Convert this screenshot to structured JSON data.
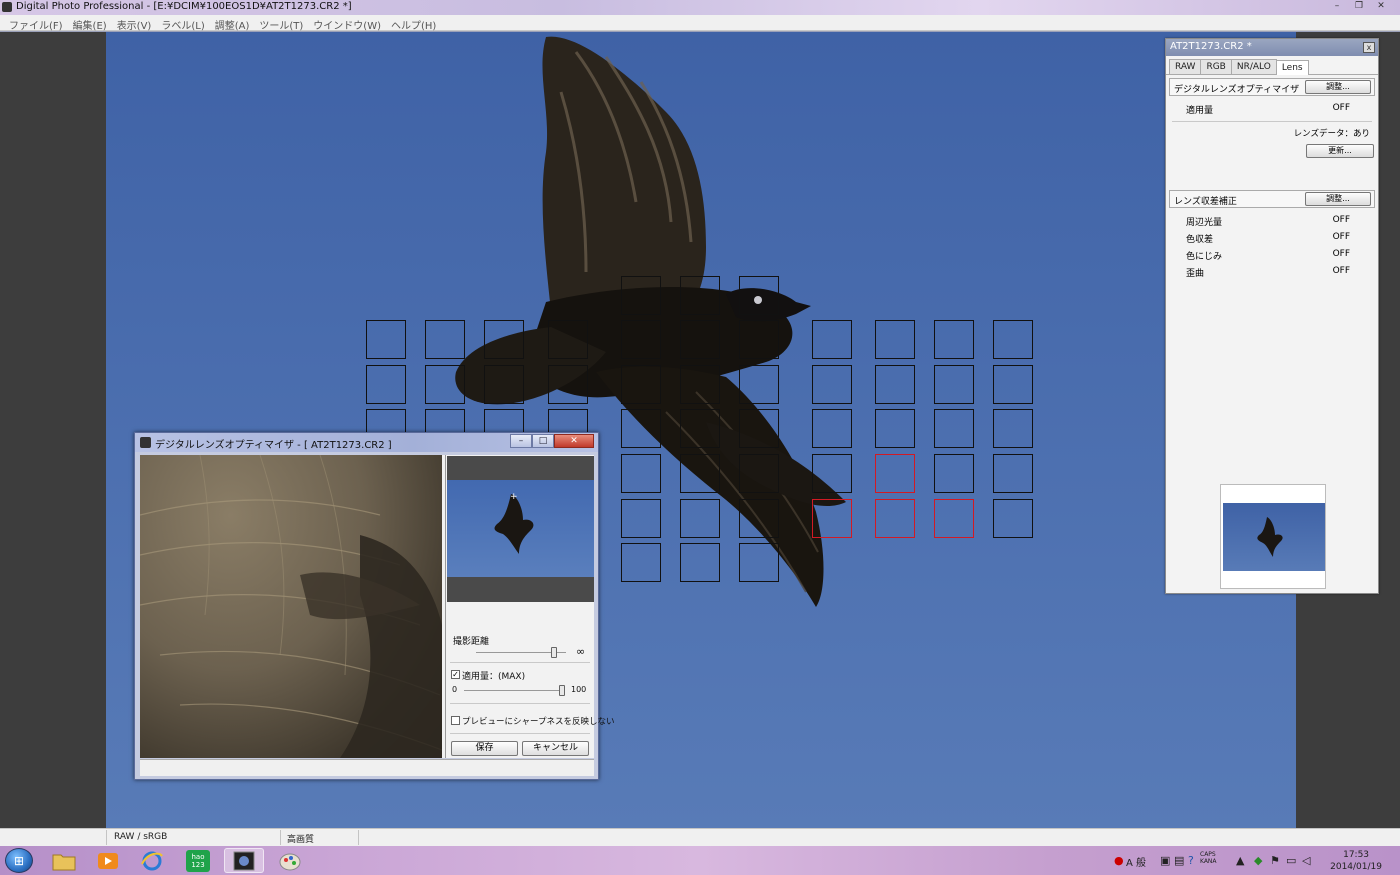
{
  "window": {
    "title": "Digital Photo Professional - [E:¥DCIM¥100EOS1D¥AT2T1273.CR2 *]",
    "minimize_glyph": "–",
    "restore_glyph": "❐",
    "close_glyph": "✕"
  },
  "menu": [
    "ファイル(F)",
    "編集(E)",
    "表示(V)",
    "ラベル(L)",
    "調整(A)",
    "ツール(T)",
    "ウインドウ(W)",
    "ヘルプ(H)"
  ],
  "af_points": {
    "active_color": "#d21a24",
    "normal_color": "#111111"
  },
  "palette": {
    "title": "AT2T1273.CR2 *",
    "close_glyph": "x",
    "tabs": [
      "RAW",
      "RGB",
      "NR/ALO",
      "Lens"
    ],
    "active_tab": "Lens",
    "dlo_section": {
      "label": "デジタルレンズオプティマイザ",
      "button": "調整...",
      "amount_label": "適用量",
      "amount_value": "OFF",
      "lens_data": "レンズデータ：あり",
      "update_button": "更新..."
    },
    "aberration_section": {
      "label": "レンズ収差補正",
      "button": "調整...",
      "rows": [
        {
          "label": "周辺光量",
          "value": "OFF"
        },
        {
          "label": "色収差",
          "value": "OFF"
        },
        {
          "label": "色にじみ",
          "value": "OFF"
        },
        {
          "label": "歪曲",
          "value": "OFF"
        }
      ]
    }
  },
  "dlo_dialog": {
    "title": "デジタルレンズオプティマイザ - [ AT2T1273.CR2 ]",
    "minimize_glyph": "–",
    "maximize_glyph": "□",
    "close_glyph": "✕",
    "distance_label": "撮影距離",
    "distance_end": "∞",
    "amount_checkbox": "適用量：(MAX)",
    "amount_checked": true,
    "amount_min": "0",
    "amount_max": "100",
    "sharpness_checkbox": "プレビューにシャープネスを反映しない",
    "sharpness_checked": false,
    "save_button": "保存",
    "cancel_button": "キャンセル"
  },
  "statusbar": {
    "color_space": "RAW / sRGB",
    "quality": "高画質"
  },
  "taskbar": {
    "start_glyph": "⊞",
    "hao_label": "hao\n123",
    "clock_time": "17:53",
    "clock_date": "2014/01/19",
    "ime_label": "A 般",
    "caps_label": "CAPS\nKANA"
  }
}
